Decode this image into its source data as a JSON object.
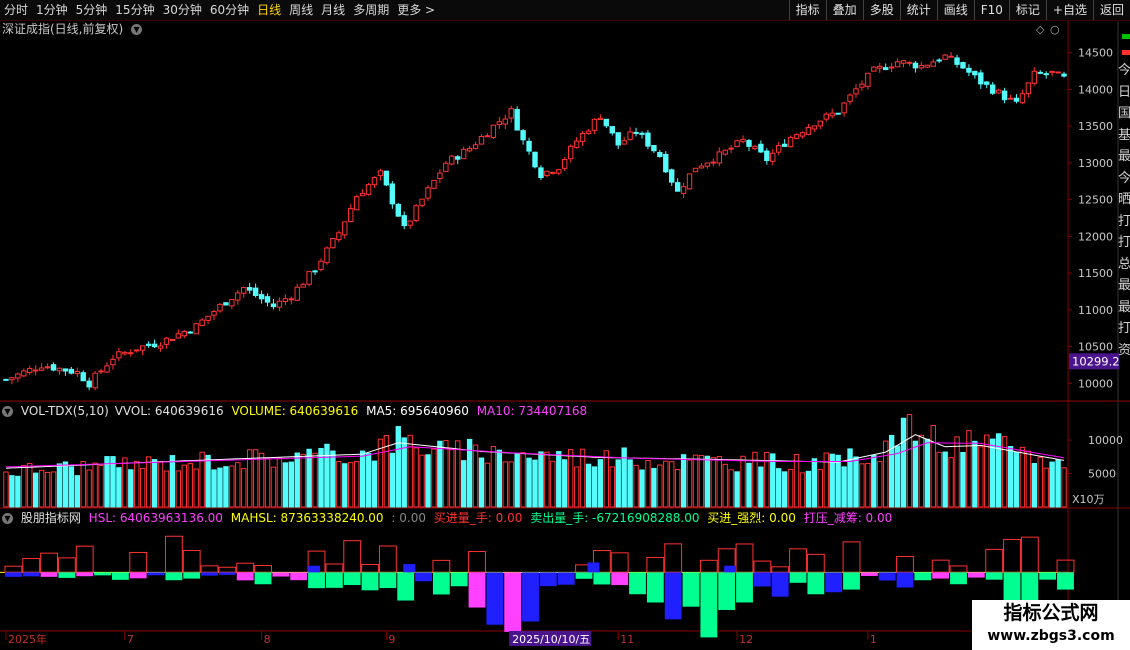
{
  "toolbar": {
    "periods": [
      "分时",
      "1分钟",
      "5分钟",
      "15分钟",
      "30分钟",
      "60分钟",
      "日线",
      "周线",
      "月线",
      "多周期",
      "更多 >"
    ],
    "active": "日线",
    "right_buttons": [
      "指标",
      "叠加",
      "多股",
      "统计",
      "画线",
      "F10",
      "标记",
      "+自选",
      "返回"
    ]
  },
  "main_title": "深证成指(日线,前复权)",
  "current_price_tag": "10299.2",
  "volume_header": {
    "name": "VOL-TDX(5,10)",
    "vvol": "VVOL: 640639616",
    "volume": "VOLUME: 640639616",
    "ma5": "MA5: 695640960",
    "ma10": "MA10: 734407168"
  },
  "volume_unit": "X10万",
  "indicator_header": {
    "name": "股朋指标网",
    "hsl": "HSL: 64063963136.00",
    "mahsl": "MAHSL: 87363338240.00",
    "blank": ": 0.00",
    "buy": "买进量_手: 0.00",
    "sell": "卖出量_手: -67216908288.00",
    "strong": "买进_强烈: 0.00",
    "press": "打压_减筹: 0.00"
  },
  "xaxis": {
    "labels": [
      {
        "text": "2025年",
        "index": 0
      },
      {
        "text": "7",
        "index": 20
      },
      {
        "text": "8",
        "index": 43
      },
      {
        "text": "9",
        "index": 64
      },
      {
        "text": "11",
        "index": 103
      },
      {
        "text": "12",
        "index": 123
      },
      {
        "text": "1",
        "index": 145
      }
    ],
    "highlight": {
      "text": "2025/10/10/五",
      "index": 87
    }
  },
  "sidebar_text": [
    "今",
    "日",
    "国",
    "基",
    "最",
    "今",
    "晒",
    "打",
    "打",
    "总",
    "最",
    "最",
    "打",
    "资"
  ],
  "watermark": {
    "line1": "指标公式网",
    "line2": "www.zbgs3.com"
  },
  "colors": {
    "up": "#ff3232",
    "down": "#54fcfc",
    "ma5": "#ffffff",
    "ma10": "#ff00ff",
    "yellow": "#ffff00",
    "pink": "#ff40ff",
    "green": "#00ff90",
    "blue": "#2020ff",
    "grid": "#8b0000"
  },
  "chart_data": [
    {
      "type": "candlestick",
      "title": "深证成指(日线,前复权)",
      "ylim": [
        9800,
        14700
      ],
      "yticks": [
        10000,
        10500,
        11000,
        11500,
        12000,
        12500,
        13000,
        13500,
        14000,
        14500
      ],
      "close_anchors": [
        [
          0,
          10050
        ],
        [
          6,
          10250
        ],
        [
          12,
          10150
        ],
        [
          14,
          10000
        ],
        [
          18,
          10350
        ],
        [
          22,
          10480
        ],
        [
          26,
          10560
        ],
        [
          32,
          10780
        ],
        [
          36,
          11050
        ],
        [
          40,
          11300
        ],
        [
          45,
          11050
        ],
        [
          48,
          11200
        ],
        [
          52,
          11560
        ],
        [
          56,
          12050
        ],
        [
          59,
          12550
        ],
        [
          63,
          12850
        ],
        [
          66,
          12300
        ],
        [
          67,
          12100
        ],
        [
          70,
          12500
        ],
        [
          74,
          13000
        ],
        [
          78,
          13200
        ],
        [
          82,
          13500
        ],
        [
          85,
          13700
        ],
        [
          87,
          13300
        ],
        [
          90,
          12850
        ],
        [
          93,
          12950
        ],
        [
          96,
          13300
        ],
        [
          100,
          13650
        ],
        [
          103,
          13250
        ],
        [
          106,
          13430
        ],
        [
          110,
          13100
        ],
        [
          113,
          12600
        ],
        [
          116,
          12950
        ],
        [
          120,
          13100
        ],
        [
          124,
          13300
        ],
        [
          128,
          13050
        ],
        [
          132,
          13350
        ],
        [
          136,
          13550
        ],
        [
          140,
          13700
        ],
        [
          143,
          14000
        ],
        [
          146,
          14250
        ],
        [
          150,
          14380
        ],
        [
          154,
          14320
        ],
        [
          158,
          14450
        ],
        [
          161,
          14300
        ],
        [
          164,
          14100
        ],
        [
          167,
          13950
        ],
        [
          170,
          13800
        ],
        [
          173,
          14200
        ],
        [
          176,
          14220
        ],
        [
          178,
          14150
        ]
      ]
    },
    {
      "type": "bar",
      "title": "VOL-TDX(5,10)",
      "unit": "X10万",
      "ylim": [
        0,
        13000
      ],
      "yticks": [
        5000,
        10000
      ],
      "series": [
        {
          "name": "VOLUME",
          "anchors": [
            [
              0,
              5500
            ],
            [
              30,
              7000
            ],
            [
              60,
              8200
            ],
            [
              66,
              10500
            ],
            [
              74,
              8600
            ],
            [
              90,
              8000
            ],
            [
              110,
              7200
            ],
            [
              140,
              6700
            ],
            [
              147,
              9000
            ],
            [
              153,
              12500
            ],
            [
              158,
              9000
            ],
            [
              164,
              10000
            ],
            [
              178,
              6400
            ]
          ]
        },
        {
          "name": "MA5",
          "anchors": [
            [
              0,
              5800
            ],
            [
              30,
              6900
            ],
            [
              60,
              7900
            ],
            [
              66,
              9600
            ],
            [
              80,
              8300
            ],
            [
              100,
              7400
            ],
            [
              120,
              7100
            ],
            [
              140,
              6700
            ],
            [
              148,
              8200
            ],
            [
              153,
              10800
            ],
            [
              158,
              9000
            ],
            [
              164,
              9200
            ],
            [
              178,
              6956
            ]
          ]
        },
        {
          "name": "MA10",
          "anchors": [
            [
              0,
              6000
            ],
            [
              30,
              6800
            ],
            [
              60,
              7600
            ],
            [
              68,
              9000
            ],
            [
              85,
              8100
            ],
            [
              105,
              7300
            ],
            [
              130,
              6800
            ],
            [
              142,
              6800
            ],
            [
              150,
              8000
            ],
            [
              155,
              9600
            ],
            [
              164,
              9500
            ],
            [
              178,
              7344
            ]
          ]
        }
      ]
    },
    {
      "type": "bar",
      "title": "股朋指标网",
      "ylim": [
        -70,
        55
      ],
      "series": [
        {
          "name": "买进量_手",
          "anchors": [
            [
              0,
              8
            ],
            [
              10,
              25
            ],
            [
              20,
              15
            ],
            [
              28,
              30
            ],
            [
              40,
              10
            ],
            [
              50,
              20
            ],
            [
              58,
              25
            ],
            [
              66,
              45
            ],
            [
              72,
              30
            ],
            [
              80,
              15
            ],
            [
              86,
              28
            ],
            [
              92,
              20
            ],
            [
              98,
              35
            ],
            [
              104,
              18
            ],
            [
              112,
              25
            ],
            [
              120,
              30
            ],
            [
              128,
              15
            ],
            [
              136,
              22
            ],
            [
              146,
              28
            ],
            [
              155,
              20
            ],
            [
              162,
              25
            ],
            [
              170,
              45
            ],
            [
              178,
              10
            ]
          ]
        },
        {
          "name": "卖出量_手",
          "anchors": [
            [
              0,
              -4
            ],
            [
              10,
              -8
            ],
            [
              20,
              -6
            ],
            [
              36,
              -8
            ],
            [
              48,
              -15
            ],
            [
              60,
              -22
            ],
            [
              66,
              -35
            ],
            [
              74,
              -15
            ],
            [
              80,
              -40
            ],
            [
              86,
              -65
            ],
            [
              90,
              -30
            ],
            [
              100,
              -20
            ],
            [
              108,
              -25
            ],
            [
              116,
              -68
            ],
            [
              126,
              -20
            ],
            [
              136,
              -25
            ],
            [
              146,
              -10
            ],
            [
              156,
              -18
            ],
            [
              166,
              -22
            ],
            [
              170,
              -40
            ],
            [
              174,
              -18
            ],
            [
              178,
              -15
            ]
          ]
        }
      ]
    }
  ]
}
